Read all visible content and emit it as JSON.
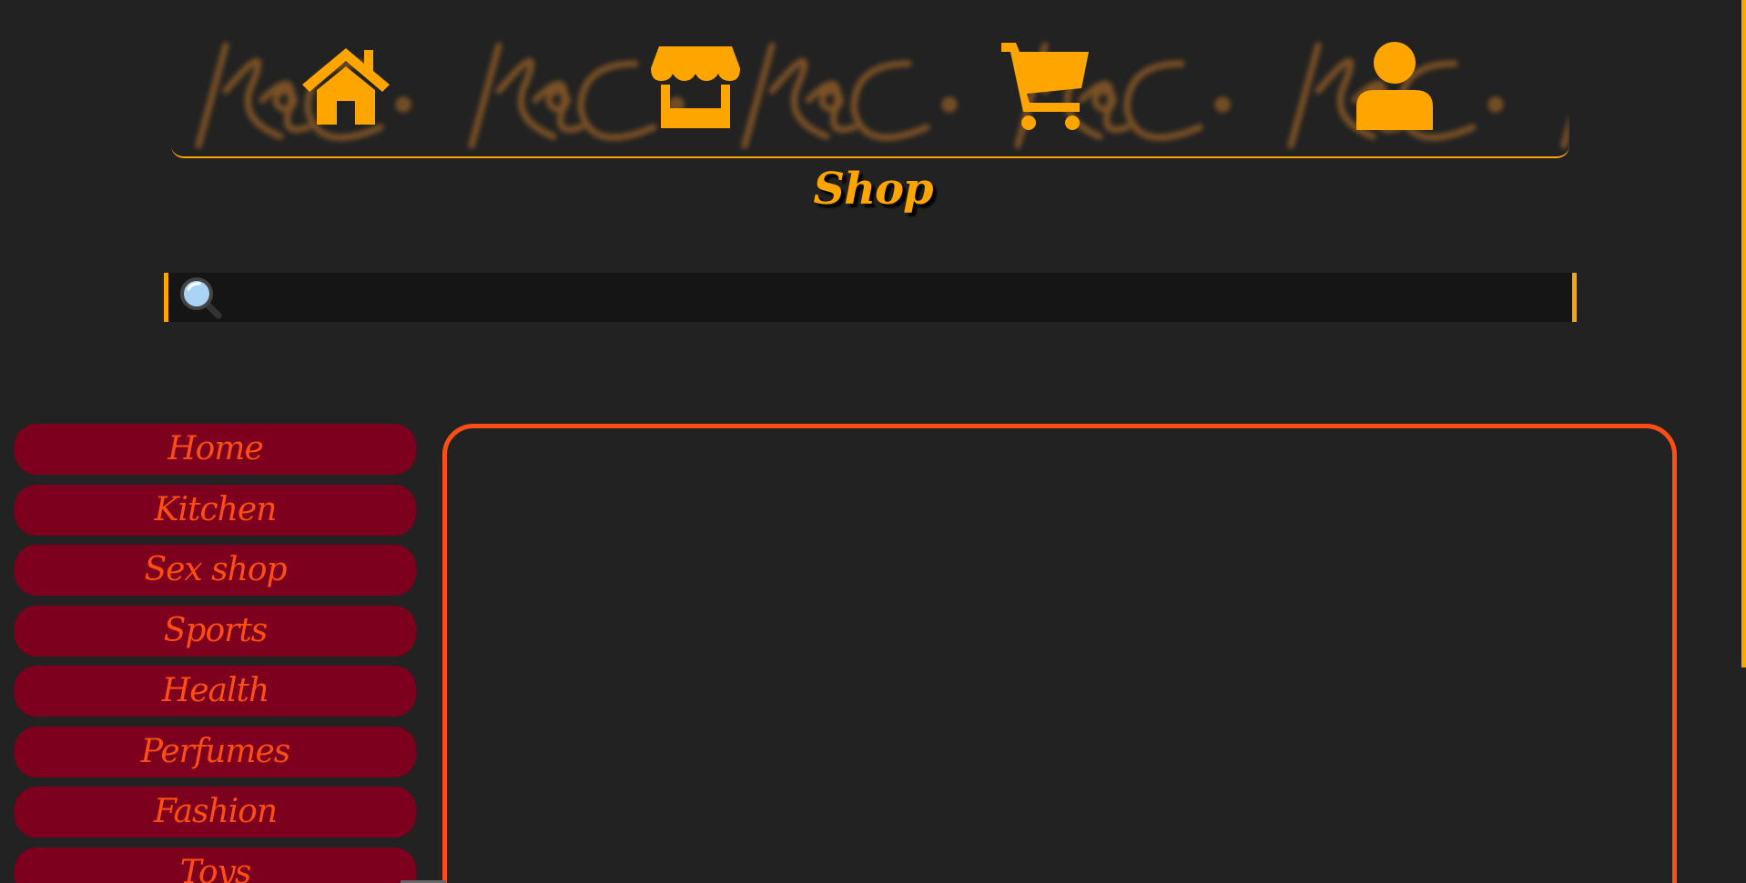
{
  "header": {
    "nav": [
      {
        "icon": "home-icon"
      },
      {
        "icon": "store-icon"
      },
      {
        "icon": "cart-icon"
      },
      {
        "icon": "user-icon"
      }
    ],
    "accent_color": "#ffa500",
    "watermark": "KBC"
  },
  "page": {
    "title": "Shop"
  },
  "search": {
    "icon": "magnifier-icon",
    "value": "",
    "placeholder": ""
  },
  "sidebar": {
    "items": [
      {
        "label": "Home"
      },
      {
        "label": "Kitchen"
      },
      {
        "label": "Sex shop"
      },
      {
        "label": "Sports"
      },
      {
        "label": "Health"
      },
      {
        "label": "Perfumes"
      },
      {
        "label": "Fashion"
      },
      {
        "label": "Toys"
      }
    ],
    "button_color": "#7d001e",
    "text_color": "#ff4e14"
  },
  "content": {
    "border_color": "#ff4e14"
  }
}
